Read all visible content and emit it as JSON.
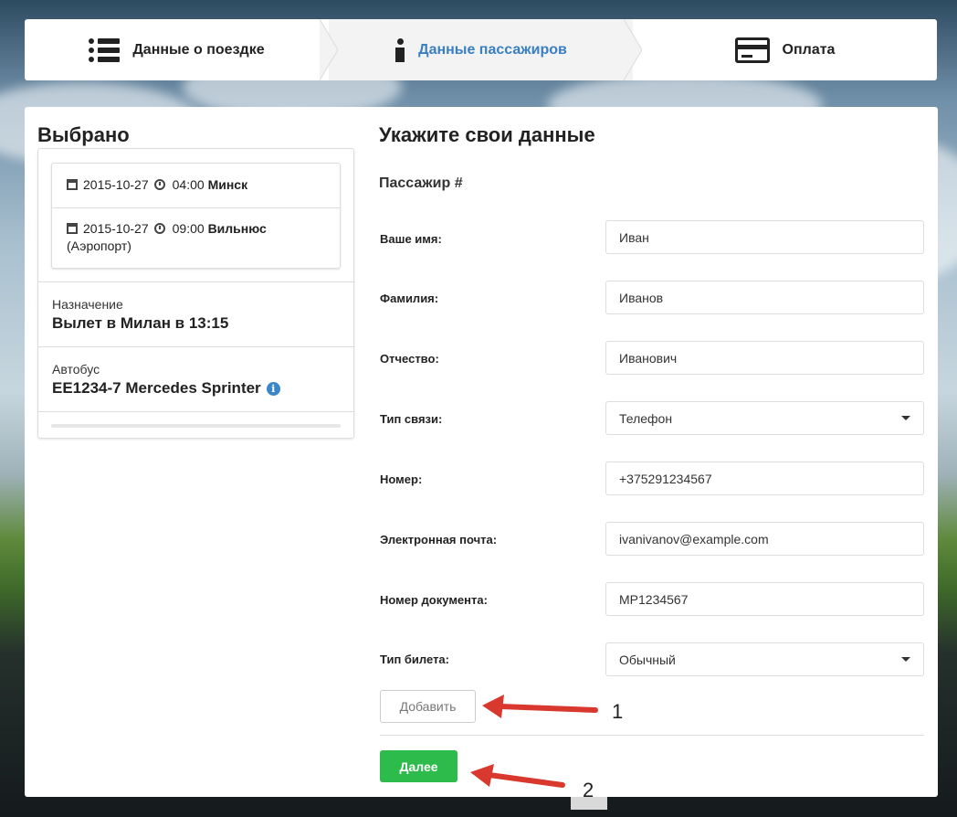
{
  "steps": [
    {
      "label": "Данные о поездке",
      "icon": "list-icon"
    },
    {
      "label": "Данные пассажиров",
      "icon": "info-icon"
    },
    {
      "label": "Оплата",
      "icon": "credit-card-icon"
    }
  ],
  "colors": {
    "active_step": "#3a7fc1",
    "next_button": "#2dbb4c",
    "info_icon": "#3a86c8"
  },
  "summary": {
    "title": "Выбрано",
    "departure": {
      "date": "2015-10-27",
      "time": "04:00",
      "city": "Минск"
    },
    "arrival": {
      "date": "2015-10-27",
      "time": "09:00",
      "city": "Вильнюс",
      "place": "(Аэропорт)"
    },
    "destination_label": "Назначение",
    "destination_value": "Вылет в Милан в 13:15",
    "bus_label": "Автобус",
    "bus_value": "EE1234-7 Mercedes Sprinter"
  },
  "form": {
    "title": "Укажите свои данные",
    "passenger_title": "Пассажир #",
    "fields": [
      {
        "label": "Ваше имя:",
        "value": "Иван",
        "type": "text"
      },
      {
        "label": "Фамилия:",
        "value": "Иванов",
        "type": "text"
      },
      {
        "label": "Отчество:",
        "value": "Иванович",
        "type": "text"
      },
      {
        "label": "Тип связи:",
        "value": "Телефон",
        "type": "select"
      },
      {
        "label": "Номер:",
        "value": "+375291234567",
        "type": "text"
      },
      {
        "label": "Электронная почта:",
        "value": "ivanivanov@example.com",
        "type": "text"
      },
      {
        "label": "Номер документа:",
        "value": "MP1234567",
        "type": "text"
      },
      {
        "label": "Тип билета:",
        "value": "Обычный",
        "type": "select"
      }
    ],
    "add_button": "Добавить",
    "next_button": "Далее"
  },
  "annotations": {
    "one": "1",
    "two": "2"
  }
}
